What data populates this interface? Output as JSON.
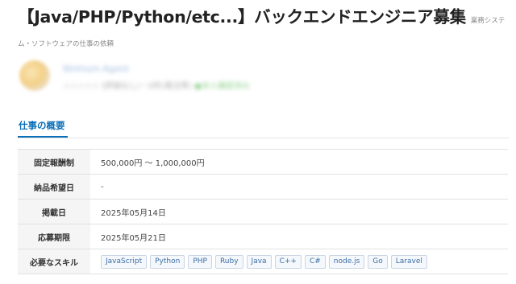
{
  "job": {
    "title": "【Java/PHP/Python/etc...】バックエンドエンジニア募集",
    "category": "業務システム・ソフトウェアの仕事の依頼"
  },
  "client": {
    "name": "Ninhium Agent",
    "meta": "☆☆☆☆☆ (評価なし)・0件(発注率)",
    "verified": "●本人確認済み"
  },
  "section": {
    "tab_label": "仕事の概要"
  },
  "details": {
    "rows": [
      {
        "label": "固定報酬制",
        "value": "500,000円 〜 1,000,000円"
      },
      {
        "label": "納品希望日",
        "value": "-"
      },
      {
        "label": "掲載日",
        "value": "2025年05月14日"
      },
      {
        "label": "応募期限",
        "value": "2025年05月21日"
      }
    ],
    "skills_label": "必要なスキル",
    "skills": [
      "JavaScript",
      "Python",
      "PHP",
      "Ruby",
      "Java",
      "C++",
      "C#",
      "node.js",
      "Go",
      "Laravel"
    ]
  }
}
